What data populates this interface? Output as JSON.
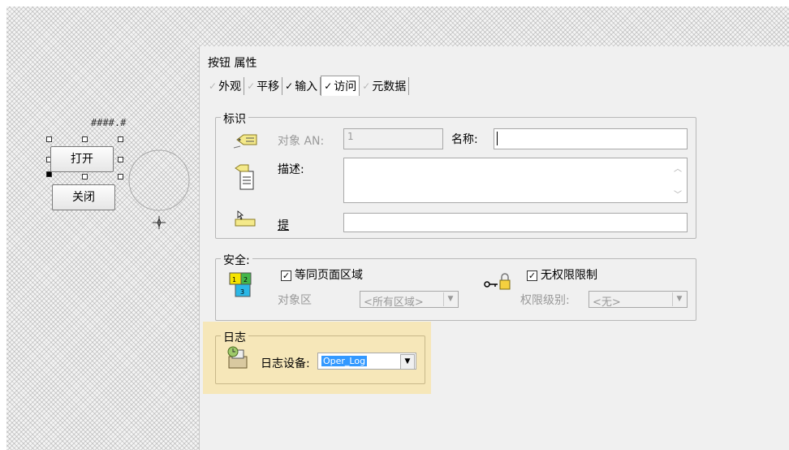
{
  "canvas": {
    "hash_label": "####.#",
    "open_button": "打开",
    "close_button": "关闭"
  },
  "dialog": {
    "title": "按钮 属性",
    "tabs": [
      {
        "label": "外观",
        "checked": false
      },
      {
        "label": "平移",
        "checked": false
      },
      {
        "label": "输入",
        "checked": true
      },
      {
        "label": "访问",
        "checked": true,
        "active": true
      },
      {
        "label": "元数据",
        "checked": false
      }
    ],
    "identification": {
      "group_title": "标识",
      "object_an_label": "对象 AN:",
      "object_an_value": "1",
      "name_label": "名称:",
      "name_value": "",
      "description_label": "描述:",
      "description_value": "",
      "tip_label": "提",
      "tip_value": ""
    },
    "security": {
      "group_title": "安全:",
      "same_area_label": "等同页面区域",
      "same_area_checked": true,
      "object_area_label": "对象区",
      "object_area_value": "<所有区域>",
      "no_permission_label": "无权限限制",
      "no_permission_checked": true,
      "permission_level_label": "权限级别:",
      "permission_level_value": "<无>"
    },
    "log": {
      "group_title": "日志",
      "device_label": "日志设备:",
      "device_value": "Oper_Log"
    }
  },
  "colors": {
    "highlight": "#f6e7b9",
    "selection": "#3399ff"
  }
}
